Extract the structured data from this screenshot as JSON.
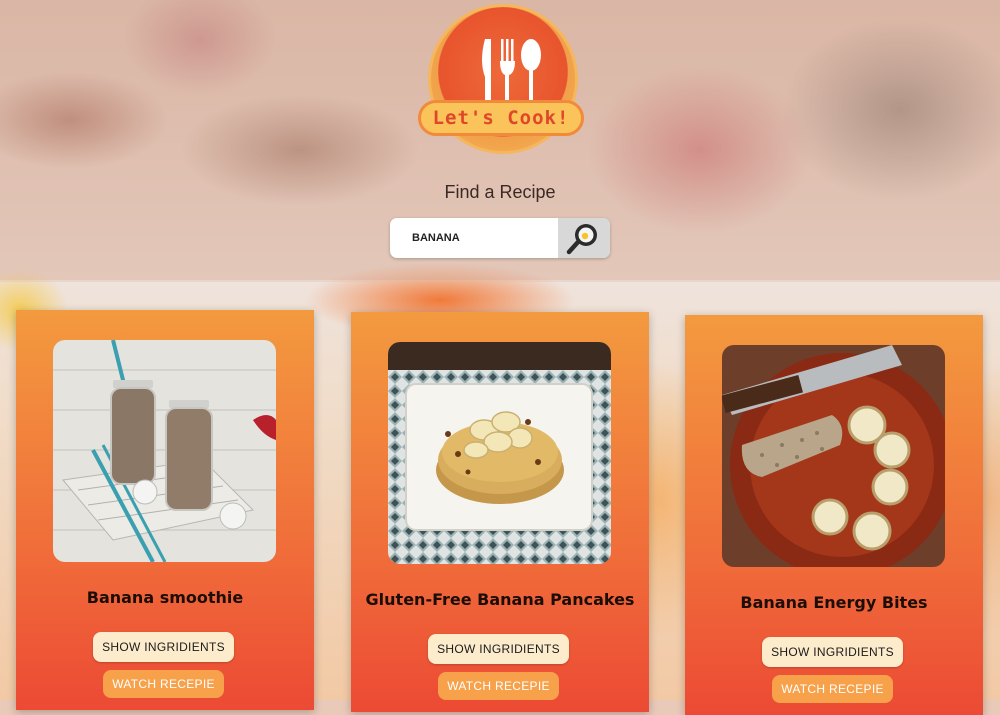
{
  "logo": {
    "text": "Let's Cook!"
  },
  "search": {
    "heading": "Find a Recipe",
    "value": "BANANA"
  },
  "recipes": [
    {
      "title": "Banana smoothie",
      "show_ingredients_label": "SHOW INGRIDIENTS",
      "watch_label": "WATCH RECEPIE"
    },
    {
      "title": "Gluten-Free Banana Pancakes",
      "show_ingredients_label": "SHOW INGRIDIENTS",
      "watch_label": "WATCH RECEPIE"
    },
    {
      "title": "Banana Energy Bites",
      "show_ingredients_label": "SHOW INGRIDIENTS",
      "watch_label": "WATCH RECEPIE"
    }
  ],
  "colors": {
    "card_top": "#f39a3f",
    "card_bottom": "#ec4a34",
    "ingredients_button": "#fdeccc",
    "watch_button": "#f7a14b",
    "logo_red": "#e8542d",
    "logo_yellow": "#fbc45a"
  },
  "icons": {
    "search_button": "frying-pan-search-icon",
    "logo": "fork-knife-spoon-icon"
  }
}
